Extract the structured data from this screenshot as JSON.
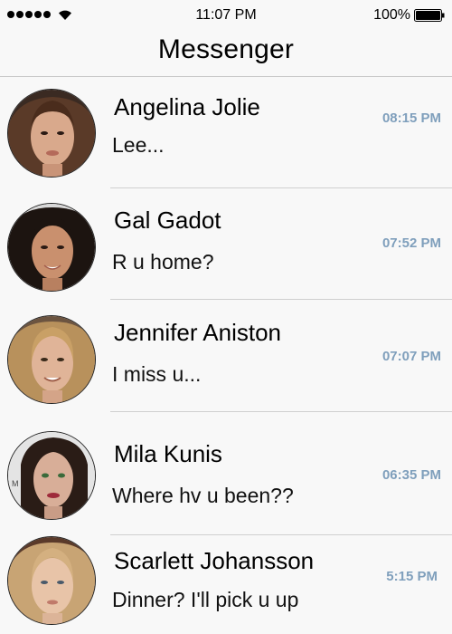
{
  "status_bar": {
    "time": "11:07 PM",
    "battery_percent": "100%",
    "signal_icon": "signal-dots-icon",
    "wifi_icon": "wifi-icon",
    "battery_icon": "battery-full-icon"
  },
  "header": {
    "title": "Messenger"
  },
  "conversations": [
    {
      "name": "Angelina Jolie",
      "message": "Lee...",
      "time": "08:15 PM"
    },
    {
      "name": "Gal Gadot",
      "message": "R u home?",
      "time": "07:52 PM"
    },
    {
      "name": "Jennifer Aniston",
      "message": "I miss u...",
      "time": "07:07 PM"
    },
    {
      "name": "Mila Kunis",
      "message": "Where hv u been??",
      "time": "06:35 PM"
    },
    {
      "name": "Scarlett Johansson",
      "message": "Dinner? I'll pick u up",
      "time": "5:15 PM"
    }
  ],
  "colors": {
    "time_text": "#7f9fbc",
    "divider": "#cfcfcf",
    "background": "#f8f8f8"
  }
}
